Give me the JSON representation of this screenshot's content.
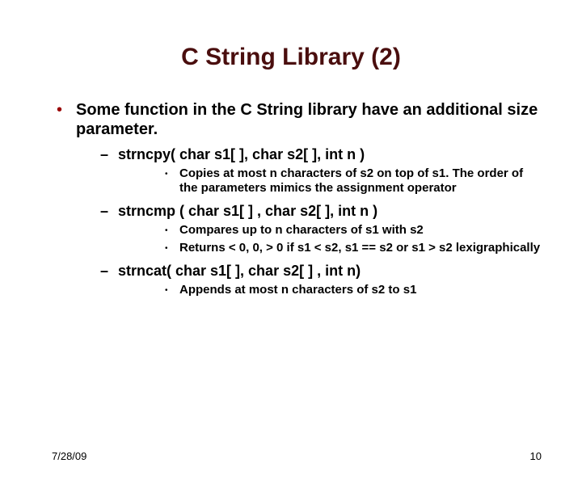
{
  "title": "C String Library (2)",
  "main_bullet": "Some function in the C String library have an additional size parameter.",
  "functions": [
    {
      "signature": "strncpy( char s1[ ], char s2[ ], int n )",
      "details": [
        "Copies at most n characters of s2 on top of s1.  The order of the parameters mimics the assignment operator"
      ]
    },
    {
      "signature": "strncmp ( char s1[ ] , char s2[ ], int n )",
      "details": [
        "Compares up to n characters of s1 with s2",
        "Returns < 0, 0, > 0 if s1 < s2, s1  == s2 or s1 > s2 lexigraphically"
      ]
    },
    {
      "signature": "strncat( char s1[ ], char s2[ ] , int n)",
      "details": [
        "Appends at most n characters of s2 to s1"
      ]
    }
  ],
  "footer": {
    "date": "7/28/09",
    "page": "10"
  }
}
